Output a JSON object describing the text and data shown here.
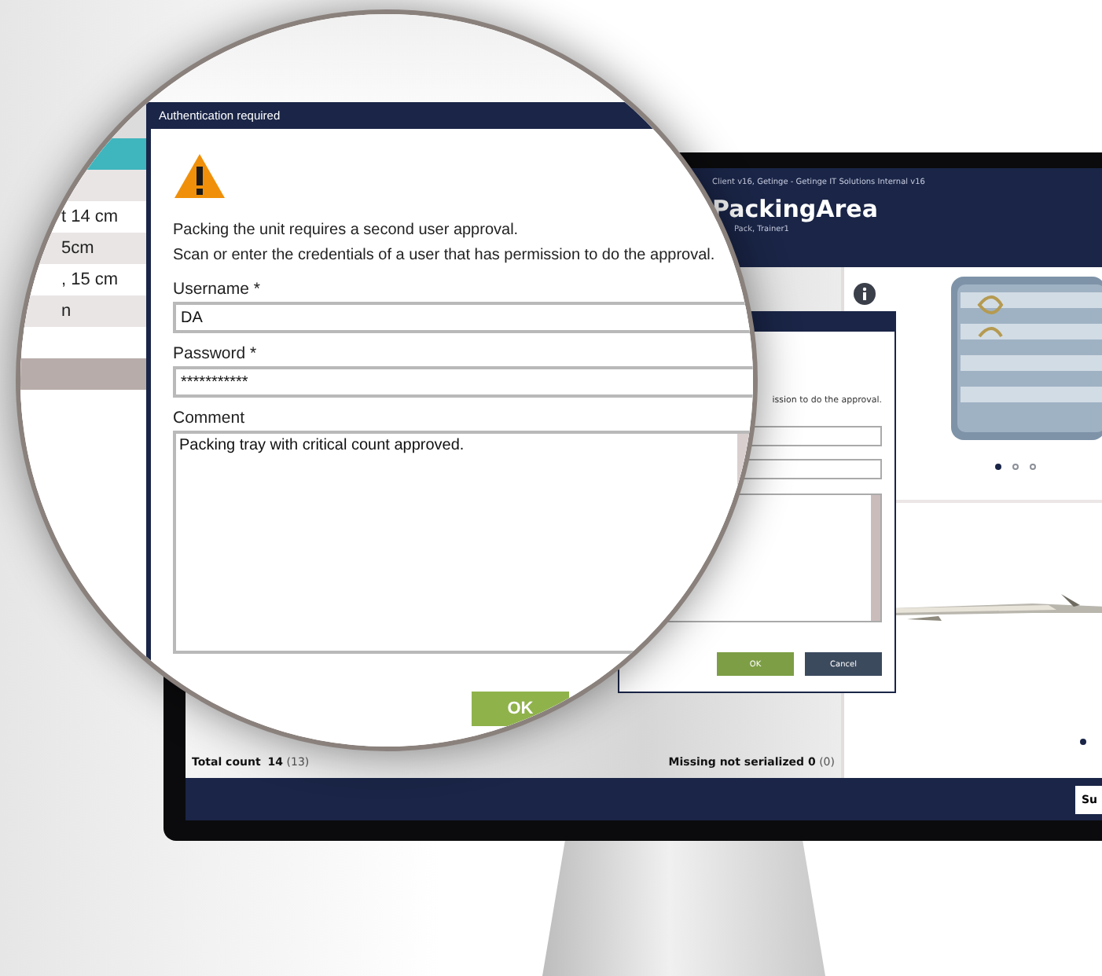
{
  "app_header": {
    "subtitle": "Client v16, Getinge - Getinge IT Solutions Internal v16",
    "title": "PackingArea",
    "user": "Pack, Trainer1"
  },
  "modal": {
    "message": "ission to do the approval.",
    "fields": [
      {
        "kind": "input"
      },
      {
        "kind": "input"
      },
      {
        "kind": "textarea"
      }
    ],
    "buttons": [
      {
        "label": "OK",
        "kind": "primary"
      },
      {
        "label": "Cancel",
        "kind": "secondary"
      }
    ]
  },
  "images": [
    {
      "kind": "tray",
      "dots": [
        {
          "selected": true
        },
        {
          "selected": false
        },
        {
          "selected": false
        }
      ]
    },
    {
      "kind": "instrument",
      "dots": [
        {
          "selected": true
        }
      ]
    }
  ],
  "totals": {
    "total_label": "Total count",
    "total_value": "14",
    "total_sub": "(13)",
    "missing_label": "Missing not serialized",
    "missing_value": "0",
    "missing_sub": "(0)"
  },
  "footer": {
    "button": "Su"
  },
  "magnifier": {
    "list_rows": [
      {
        "selected": false
      },
      {
        "text": "t 14 cm",
        "selected": false
      },
      {
        "text": "5cm",
        "selected": false
      },
      {
        "text": ", 15 cm",
        "selected": false
      },
      {
        "text": "n",
        "selected": false
      },
      {
        "selected": false
      },
      {
        "selected": true
      },
      {
        "selected": false
      }
    ],
    "dialog": {
      "title": "Authentication required",
      "messages": [
        "Packing the unit requires a second user approval.",
        "Scan or enter the credentials of a user that has permission to do the approval."
      ],
      "fields": [
        {
          "label": "Username *",
          "value": "DA",
          "kind": "text"
        },
        {
          "label": "Password *",
          "value": "***********",
          "kind": "text"
        },
        {
          "label": "Comment",
          "value": "Packing tray with critical count approved.",
          "kind": "textarea"
        }
      ],
      "buttons": [
        {
          "label": "OK",
          "kind": "primary"
        }
      ]
    }
  }
}
